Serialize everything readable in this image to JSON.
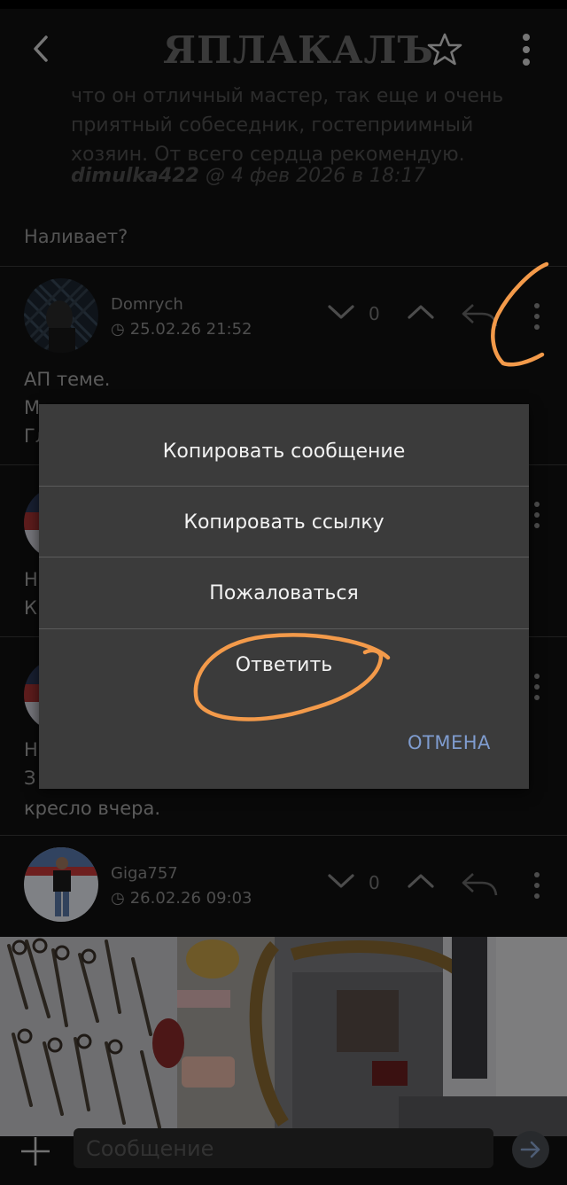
{
  "app": {
    "logo_text": "ЯПЛАКАЛЪ",
    "accent_color": "#7f9ccf",
    "annotation_color": "#f39a4a"
  },
  "topbar": {
    "back_icon": "chevron-left-icon",
    "favorite_icon": "star-outline-icon",
    "menu_icon": "more-vert-icon"
  },
  "thread": {
    "quote_lines": [
      "что он отличный мастер, так еще и очень",
      "приятный собеседник, гостеприимный",
      "хозяин. От всего сердца рекомендую."
    ],
    "quote_author": "dimulka422",
    "quote_meta": " @ 4 фев 2026 в 18:17",
    "reply_text": "Наливает?"
  },
  "posts": [
    {
      "author": "Domrych",
      "date": "25.02.26 21:52",
      "votes": "0",
      "lines": [
        "АП теме.",
        "М",
        "Гл"
      ]
    },
    {
      "author": "",
      "date": "",
      "lines": [
        "Н",
        "К"
      ]
    },
    {
      "author": "",
      "date": "",
      "lines": [
        "Н",
        "З",
        "кресло вчера."
      ]
    },
    {
      "author": "Giga757",
      "date": "26.02.26 09:03",
      "votes": "0",
      "lines": []
    }
  ],
  "context_menu": {
    "options": [
      "Копировать сообщение",
      "Копировать ссылку",
      "Пожаловаться",
      "Ответить"
    ],
    "cancel_label": "ОТМЕНА"
  },
  "composer": {
    "placeholder": "Сообщение",
    "add_icon": "plus-icon",
    "send_icon": "send-arrow-icon"
  }
}
